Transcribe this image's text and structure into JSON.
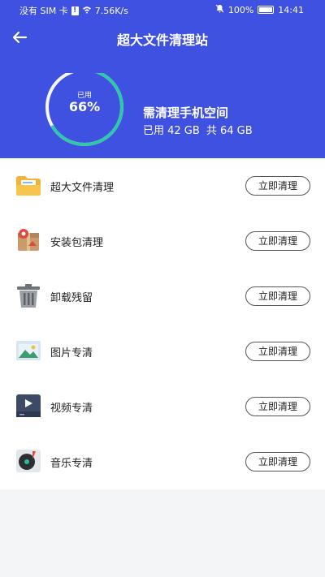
{
  "status_bar": {
    "carrier": "没有 SIM 卡",
    "network_speed": "7.56K/s",
    "battery": "100%",
    "time": "14:41"
  },
  "header": {
    "title": "超大文件清理站"
  },
  "storage": {
    "used_label": "已用",
    "used_percent": "66%",
    "used_fraction": 0.66,
    "heading": "需清理手机空间",
    "used_text": "已用 42 GB",
    "total_text": "共 64 GB"
  },
  "colors": {
    "header_bg": "#3f51e0",
    "ring_progress": "#2fc8a8"
  },
  "items": [
    {
      "label": "超大文件清理",
      "button": "立即清理",
      "icon": "folder-icon"
    },
    {
      "label": "安装包清理",
      "button": "立即清理",
      "icon": "package-icon"
    },
    {
      "label": "卸载残留",
      "button": "立即清理",
      "icon": "trash-icon"
    },
    {
      "label": "图片专清",
      "button": "立即清理",
      "icon": "image-icon"
    },
    {
      "label": "视频专清",
      "button": "立即清理",
      "icon": "video-icon"
    },
    {
      "label": "音乐专清",
      "button": "立即清理",
      "icon": "music-icon"
    }
  ]
}
